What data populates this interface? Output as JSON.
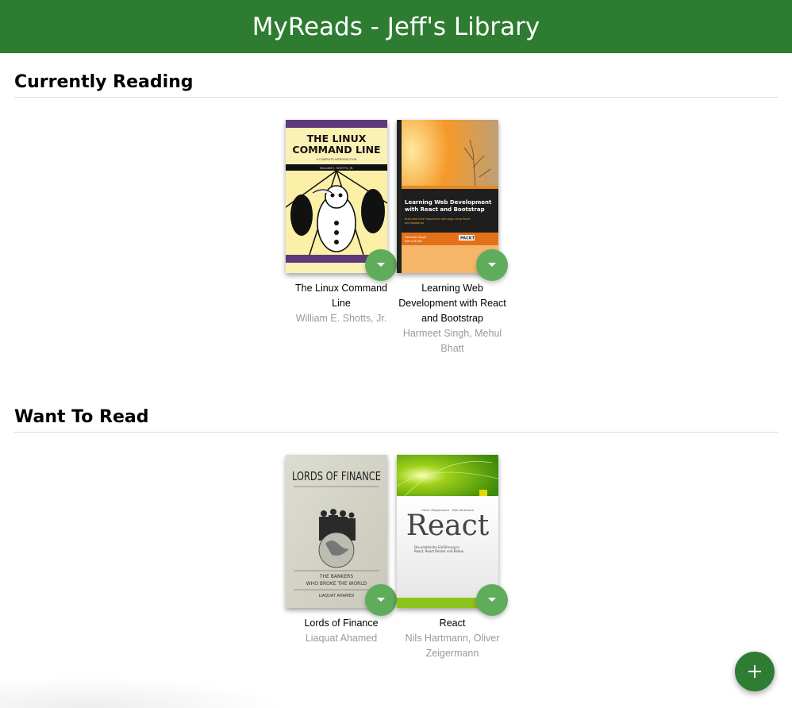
{
  "header": {
    "title": "MyReads - Jeff's Library"
  },
  "colors": {
    "header_bg": "#2e7c31",
    "changer_bg": "#60ac5d",
    "fab_bg": "#2e7d32",
    "author_text": "#999999"
  },
  "shelves": [
    {
      "title": "Currently Reading",
      "books": [
        {
          "title": "The Linux Command Line",
          "authors": "William E. Shotts, Jr.",
          "cover": {
            "line1": "THE LINUX",
            "line2": "COMMAND LINE",
            "subtitle": "A COMPLETE INTRODUCTION",
            "author": "WILLIAM E. SHOTTS, JR."
          }
        },
        {
          "title": "Learning Web Development with React and Bootstrap",
          "authors": "Harmeet Singh, Mehul Bhatt",
          "cover": {
            "title": "Learning Web Development with React and Bootstrap",
            "tagline": "Build real-time responsive web apps using React and Bootstrap",
            "authors": "Harmeet Singh Mehul Bhatt",
            "publisher": "PACKT"
          }
        }
      ]
    },
    {
      "title": "Want To Read",
      "books": [
        {
          "title": "Lords of Finance",
          "authors": "Liaquat Ahamed",
          "cover": {
            "title": "LORDS OF FINANCE",
            "sub1": "THE BANKERS",
            "sub2": "WHO BROKE THE WORLD",
            "author": "LIAQUAT AHAMED"
          }
        },
        {
          "title": "React",
          "authors": "Nils Hartmann, Oliver Zeigermann",
          "cover": {
            "authors": "Oliver Zeigermann · Nils Hartmann",
            "title": "React",
            "tagline1": "Die praktische Einführung in",
            "tagline2": "React, React Router und Redux"
          }
        }
      ]
    }
  ],
  "icons": {
    "changer": "triangle-down-icon",
    "add": "plus-icon"
  }
}
